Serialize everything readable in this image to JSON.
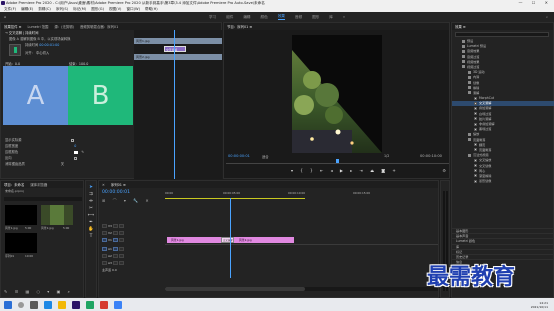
{
  "window": {
    "title": "Adobe Premiere Pro 2020 - C:\\用户\\Asus\\桌面\\素材\\Adobe Premiere Pro 2020 从新手到高手\\第3章\\3.4 添加文件\\Adobe Premiere Pro Auto-Save\\未命名"
  },
  "menu": [
    "文件(F)",
    "编辑(E)",
    "剪辑(C)",
    "序列(S)",
    "标记(M)",
    "图形(G)",
    "视图(V)",
    "窗口(W)",
    "帮助(H)"
  ],
  "workspaces": [
    "学习",
    "组件",
    "编辑",
    "颜色",
    "效果",
    "音频",
    "图形",
    "库",
    "»"
  ],
  "effect_controls": {
    "tabs": [
      "效果控件 ≡",
      "Lumetri 范围",
      "源：(无剪辑)",
      "音频剪辑混合器：序列01"
    ],
    "header": "→ 交叉溶解 | 持续时间",
    "description": "图像 A 溶解到图像 B 中，以实现场景转换",
    "duration": "00:00:01:00",
    "alignment": "中心切入",
    "start_label": "开始：0.0",
    "end_label": "结束：100.0",
    "swatch_a": "A",
    "swatch_b": "B",
    "show_actual": "显示实际源",
    "reverse": "反向",
    "border_width": "边框宽度",
    "border_color": "边框颜色",
    "anti_alias": "消除锯齿品质",
    "anti_alias_val": "关",
    "mini_clip1": "风景1.jpg",
    "mini_clip2": "风景2.jpg",
    "mini_transition": "交叉溶解"
  },
  "program": {
    "tab": "节目：序列01 ≡",
    "timecode": "00:00:00:01",
    "fit": "适合",
    "quality": "1/2",
    "duration": "00:00:10:00"
  },
  "project": {
    "tabs": [
      "项目：未命名",
      "媒体浏览器"
    ],
    "file": "未命名.prproj",
    "items": [
      "风景1.jpg",
      "风景2.jpg",
      "序列01"
    ],
    "durations": [
      "5:00",
      "5:00",
      "10:00"
    ]
  },
  "timeline": {
    "tab": "序列01 ≡",
    "timecode": "00:00:00:01",
    "ruler": [
      "00:00",
      "00:00:05:00",
      "00:00:10:00",
      "00:00:15:00"
    ],
    "tracks": [
      "V3",
      "V2",
      "V1",
      "A1",
      "A2",
      "A3"
    ],
    "master": "主声道",
    "master_val": "0.0",
    "clip1": "风景1.jpg",
    "clip2": "风景2.jpg",
    "transition": "交叉溶解"
  },
  "effects": {
    "tab": "效果 ≡",
    "items": [
      {
        "label": "预设",
        "lvl": 0
      },
      {
        "label": "Lumetri 预设",
        "lvl": 0
      },
      {
        "label": "音频效果",
        "lvl": 0
      },
      {
        "label": "音频过渡",
        "lvl": 0
      },
      {
        "label": "视频效果",
        "lvl": 0
      },
      {
        "label": "视频过渡",
        "lvl": 0
      },
      {
        "label": "3D 运动",
        "lvl": 1
      },
      {
        "label": "内滑",
        "lvl": 1
      },
      {
        "label": "划像",
        "lvl": 1
      },
      {
        "label": "擦除",
        "lvl": 1
      },
      {
        "label": "溶解",
        "lvl": 1
      },
      {
        "label": "MorphCut",
        "lvl": 2
      },
      {
        "label": "交叉溶解",
        "lvl": 2
      },
      {
        "label": "叠加溶解",
        "lvl": 2
      },
      {
        "label": "白场过渡",
        "lvl": 2
      },
      {
        "label": "胶片溶解",
        "lvl": 2
      },
      {
        "label": "非叠加溶解",
        "lvl": 2
      },
      {
        "label": "黑场过渡",
        "lvl": 2
      },
      {
        "label": "缩放",
        "lvl": 1
      },
      {
        "label": "页面剥落",
        "lvl": 1
      },
      {
        "label": "翻页",
        "lvl": 2
      },
      {
        "label": "页面剥落",
        "lvl": 2
      },
      {
        "label": "沉浸式视频",
        "lvl": 1
      },
      {
        "label": "交叉缩放",
        "lvl": 2
      },
      {
        "label": "交叉划像",
        "lvl": 2
      },
      {
        "label": "同心",
        "lvl": 2
      },
      {
        "label": "渐变擦除",
        "lvl": 2
      },
      {
        "label": "菱形划像",
        "lvl": 2
      }
    ],
    "bottom": [
      "基本图形",
      "基本声音",
      "Lumetri 颜色",
      "库",
      "标记",
      "历史记录",
      "信息"
    ]
  },
  "taskbar": {
    "time": "14:21",
    "date": "2021/10/11"
  },
  "watermark": "最需教育",
  "colors": {
    "accent": "#4aa3ff",
    "clip": "#e088e0",
    "swatchA": "#5d8ed3",
    "swatchB": "#1fb87a",
    "watermark": "#1f3fb0"
  }
}
